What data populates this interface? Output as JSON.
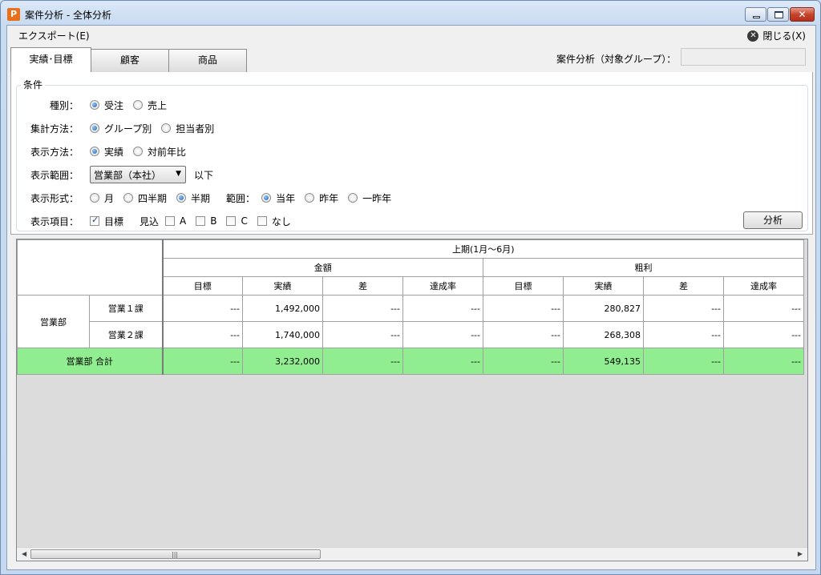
{
  "window": {
    "title": "案件分析 - 全体分析",
    "icon_letter": "P",
    "minimize_glyph": "",
    "maximize_glyph": "",
    "close_glyph": "✕"
  },
  "menu": {
    "export": "エクスポート(E)",
    "close": "閉じる(X)",
    "close_icon_glyph": "✕"
  },
  "tabs": [
    {
      "label": "実績･目標",
      "active": true
    },
    {
      "label": "顧客",
      "active": false
    },
    {
      "label": "商品",
      "active": false
    }
  ],
  "group": {
    "label": "案件分析（対象グループ）：",
    "value": ""
  },
  "conditions": {
    "legend": "条件",
    "type": {
      "label": "種別：",
      "options": [
        "受注",
        "売上"
      ],
      "selected": 0
    },
    "aggregation": {
      "label": "集計方法：",
      "options": [
        "グループ別",
        "担当者別"
      ],
      "selected": 0
    },
    "display_method": {
      "label": "表示方法：",
      "options": [
        "実績",
        "対前年比"
      ],
      "selected": 0
    },
    "display_range": {
      "label": "表示範囲：",
      "selected": "営業部（本社）",
      "suffix": "以下"
    },
    "display_format": {
      "label": "表示形式：",
      "options": [
        "月",
        "四半期",
        "半期"
      ],
      "selected": 2
    },
    "range": {
      "label": "範囲：",
      "options": [
        "当年",
        "昨年",
        "一昨年"
      ],
      "selected": 0
    },
    "display_items": {
      "label": "表示項目：",
      "target": {
        "label": "目標",
        "checked": true
      },
      "forecast_label": "見込",
      "items": [
        {
          "label": "A",
          "checked": false
        },
        {
          "label": "B",
          "checked": false
        },
        {
          "label": "C",
          "checked": false
        },
        {
          "label": "なし",
          "checked": false
        }
      ]
    },
    "analyze_button": "分析"
  },
  "grid": {
    "period": "上期(1月～6月)",
    "groups": [
      "金額",
      "粗利"
    ],
    "columns": [
      "目標",
      "実績",
      "差",
      "達成率",
      "目標",
      "実績",
      "差",
      "達成率"
    ],
    "department": "営業部",
    "rows": [
      {
        "section": "営業１課",
        "values": [
          "---",
          "1,492,000",
          "---",
          "---",
          "---",
          "280,827",
          "---",
          "---"
        ]
      },
      {
        "section": "営業２課",
        "values": [
          "---",
          "1,740,000",
          "---",
          "---",
          "---",
          "268,308",
          "---",
          "---"
        ]
      }
    ],
    "total": {
      "label": "営業部 合計",
      "values": [
        "---",
        "3,232,000",
        "---",
        "---",
        "---",
        "549,135",
        "---",
        "---"
      ]
    }
  },
  "scrollbar": {
    "left_arrow": "◀",
    "right_arrow": "▶",
    "grip": "|||"
  }
}
